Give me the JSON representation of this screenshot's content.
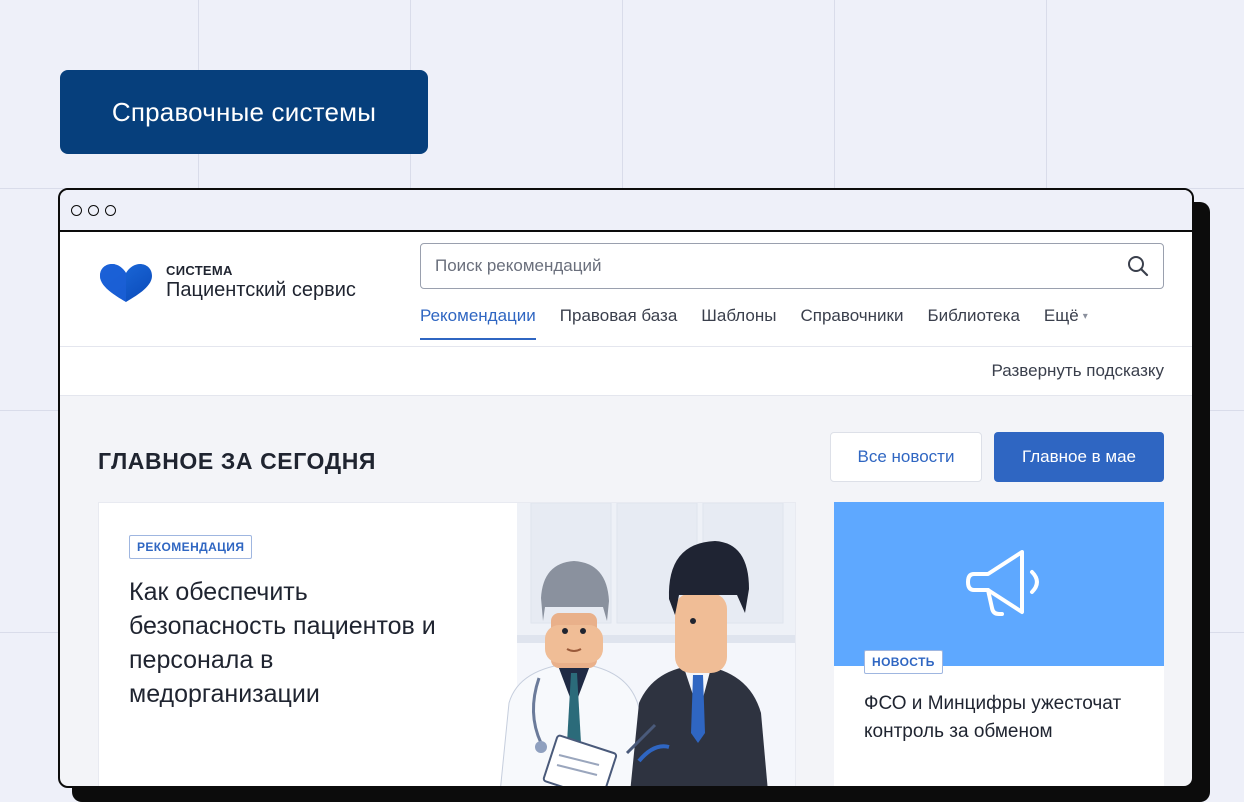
{
  "badge": {
    "label": "Справочные системы"
  },
  "app": {
    "logo_small": "СИСТЕМА",
    "logo_big": "Пациентский сервис",
    "brand_color": "#2f66c2"
  },
  "search": {
    "placeholder": "Поиск рекомендаций",
    "value": ""
  },
  "nav": {
    "items": [
      {
        "label": "Рекомендации",
        "active": true
      },
      {
        "label": "Правовая база"
      },
      {
        "label": "Шаблоны"
      },
      {
        "label": "Справочники"
      },
      {
        "label": "Библиотека"
      },
      {
        "label": "Ещё"
      }
    ]
  },
  "hint": {
    "label": "Развернуть подсказку"
  },
  "main": {
    "title": "ГЛАВНОЕ ЗА СЕГОДНЯ",
    "btn_all_news": "Все новости",
    "btn_main_month": "Главное в мае"
  },
  "card_main": {
    "tag": "РЕКОМЕНДАЦИЯ",
    "title": "Как обеспечить безопасность пациентов и персонала в медорганизации"
  },
  "card_news": {
    "tag": "НОВОСТЬ",
    "title": "ФСО и Минцифры ужесточат контроль за обменом",
    "banner_color": "#5ea8ff"
  }
}
